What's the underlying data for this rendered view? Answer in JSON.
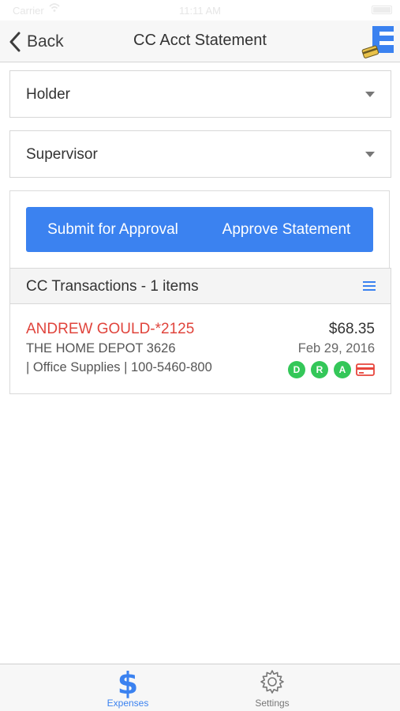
{
  "status_bar": {
    "carrier": "Carrier",
    "time": "11:11 AM"
  },
  "nav": {
    "back_label": "Back",
    "title": "CC Acct Statement",
    "logo_letter": "E"
  },
  "fields": {
    "holder_label": "Holder",
    "supervisor_label": "Supervisor"
  },
  "actions": {
    "submit_label": "Submit for Approval",
    "approve_label": "Approve Statement"
  },
  "transactions": {
    "header": "CC Transactions - 1 items",
    "items": [
      {
        "name": "ANDREW GOULD-*2125",
        "amount": "$68.35",
        "merchant": "THE HOME DEPOT 3626",
        "date": "Feb 29, 2016",
        "category": "| Office Supplies | 100-5460-800",
        "badges": [
          "D",
          "R",
          "A"
        ]
      }
    ]
  },
  "tabs": {
    "expenses_label": "Expenses",
    "settings_label": "Settings"
  },
  "colors": {
    "accent": "#3b82f0",
    "name_red": "#e0443c",
    "badge_green": "#34c759",
    "card_red": "#e8453c"
  },
  "icons": {
    "back": "chevron-left-icon",
    "dropdown": "caret-down-icon",
    "menu": "hamburger-menu-icon",
    "card": "credit-card-icon",
    "expenses": "dollar-icon",
    "settings": "gear-icon"
  }
}
